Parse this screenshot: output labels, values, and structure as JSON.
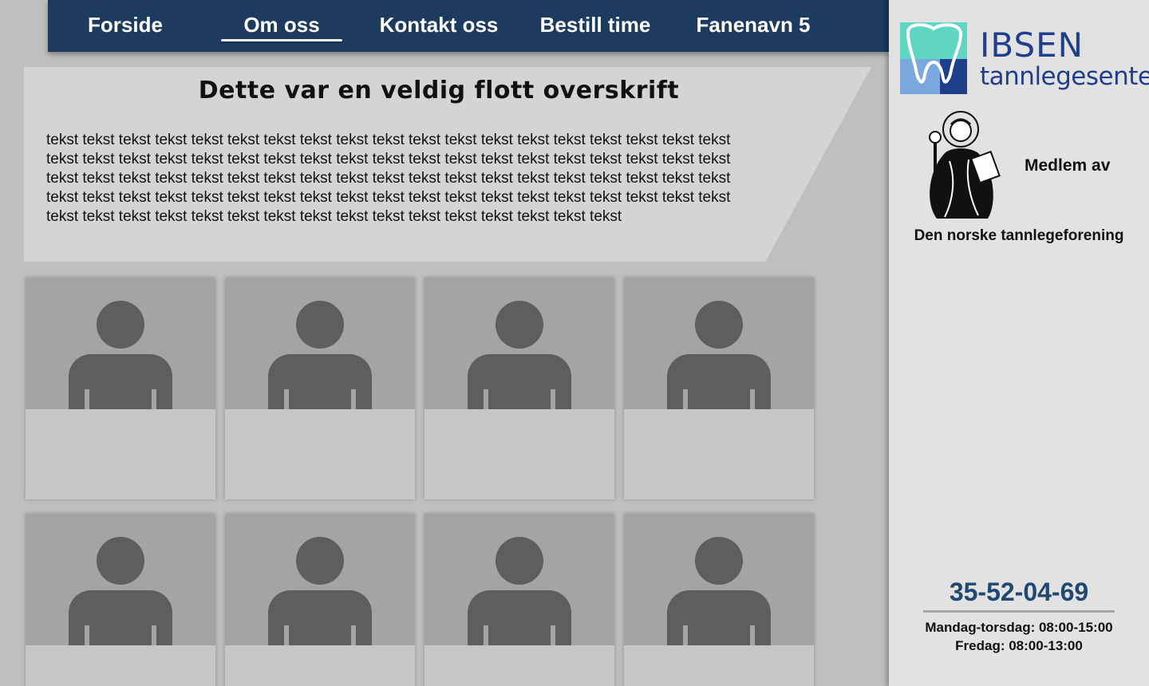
{
  "nav": {
    "items": [
      {
        "label": "Forside",
        "active": false
      },
      {
        "label": "Om oss",
        "active": true
      },
      {
        "label": "Kontakt oss",
        "active": false
      },
      {
        "label": "Bestill time",
        "active": false
      },
      {
        "label": "Fanenavn 5",
        "active": false
      }
    ]
  },
  "intro": {
    "title": "Dette var en veldig flott overskrift",
    "body": "tekst tekst tekst tekst tekst tekst tekst tekst tekst tekst tekst tekst tekst tekst tekst tekst tekst tekst tekst tekst tekst tekst tekst tekst tekst tekst tekst tekst tekst tekst tekst tekst tekst tekst tekst tekst tekst tekst tekst tekst tekst tekst tekst tekst tekst tekst tekst tekst tekst tekst tekst tekst tekst tekst tekst tekst tekst tekst tekst tekst tekst tekst tekst tekst tekst tekst tekst tekst tekst tekst tekst tekst tekst tekst tekst tekst tekst tekst tekst tekst tekst tekst tekst tekst tekst tekst tekst tekst tekst tekst tekst tekst"
  },
  "staff_grid": {
    "icon": "person-placeholder-icon",
    "cards": 8
  },
  "sidebar": {
    "logo": {
      "title": "IBSEN",
      "subtitle": "tannlegesenter",
      "colors": {
        "teal": "#5fd6c4",
        "blue": "#7aa7de",
        "navy": "#1f3f8c"
      }
    },
    "member_label": "Medlem av",
    "association": "Den norske tannlegeforening",
    "emblem_icon": "saint-apollonia-emblem-icon",
    "phone": "35-52-04-69",
    "hours": [
      "Mandag-torsdag: 08:00-15:00",
      "Fredag: 08:00-13:00"
    ]
  },
  "colors": {
    "nav_bg": "#1d3b5e",
    "phone": "#21486e",
    "sidebar_bg": "#e2e2e2",
    "page_bg": "#bfbfbf"
  }
}
